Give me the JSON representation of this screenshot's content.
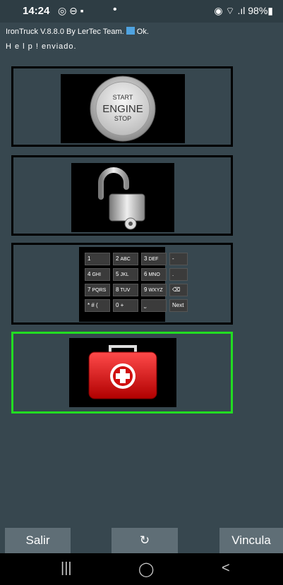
{
  "statusbar": {
    "time": "14:24",
    "left_icons": "◎ ⊖ ▪",
    "dot": "•",
    "right": "◉ ⌔ .ıl 98%▮"
  },
  "info": {
    "line1_prefix": "IronTruck  V.8.8.0  By LerTec Team.",
    "line1_ok": "Ok.",
    "line2": "H e l p !  enviado."
  },
  "tiles": [
    {
      "name": "start-engine",
      "label_lines": [
        "START",
        "ENGINE",
        "STOP"
      ]
    },
    {
      "name": "unlock"
    },
    {
      "name": "keypad"
    },
    {
      "name": "help-kit"
    }
  ],
  "keypad": {
    "rows": [
      [
        [
          "1",
          ""
        ],
        [
          "2",
          "ABC"
        ],
        [
          "3",
          "DEF"
        ],
        [
          "-",
          ""
        ]
      ],
      [
        [
          "4",
          "GHI"
        ],
        [
          "5",
          "JKL"
        ],
        [
          "6",
          "MNO"
        ],
        [
          ".",
          ""
        ]
      ],
      [
        [
          "7",
          "PQRS"
        ],
        [
          "8",
          "TUV"
        ],
        [
          "9",
          "WXYZ"
        ],
        [
          "⌫",
          ""
        ]
      ],
      [
        [
          "* # (",
          ""
        ],
        [
          "0 +",
          ""
        ],
        [
          "⎵",
          ""
        ],
        [
          "Next",
          ""
        ]
      ]
    ]
  },
  "buttons": {
    "salir": "Salir",
    "refresh": "↻",
    "vincula": "Vincula"
  },
  "navbar": {
    "recents": "|||",
    "home": "◯",
    "back": "<"
  },
  "colors": {
    "background": "#37474f",
    "selected_border": "#22dd22",
    "button": "#5f6e76"
  }
}
